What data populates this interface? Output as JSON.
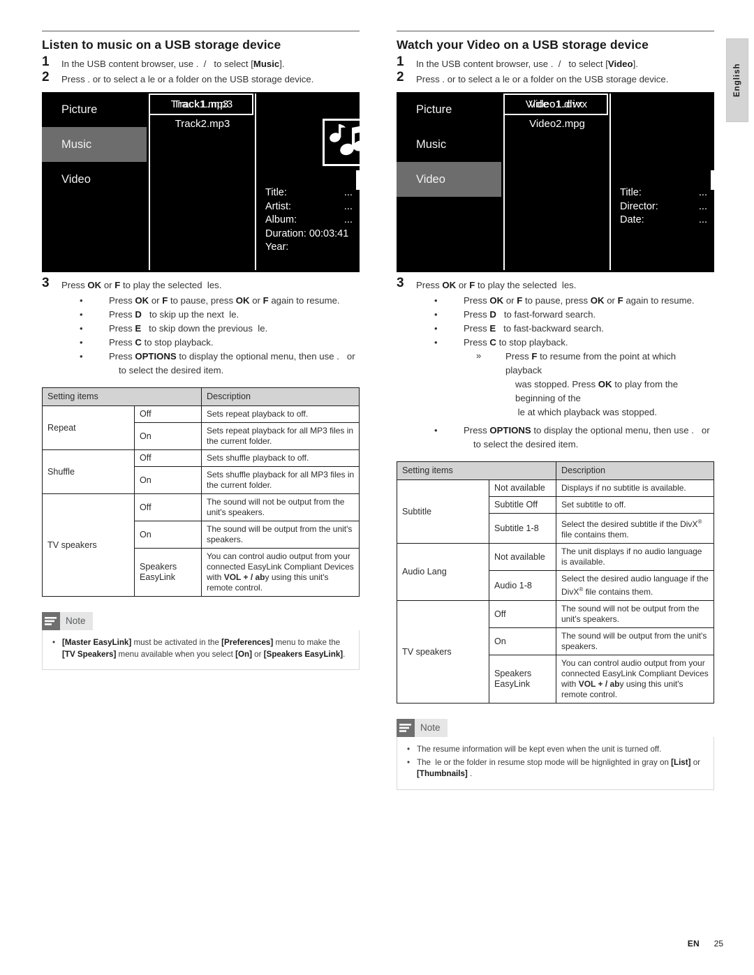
{
  "page": {
    "side_tab_label": "English",
    "footer_lang": "EN",
    "footer_page": "25"
  },
  "left": {
    "title": "Listen to music on a USB storage device",
    "steps": [
      {
        "num": "1",
        "text": "In the USB content browser, use .  /   to select [Music]."
      },
      {
        "num": "2",
        "text": "Press .   or    to select a  le or a folder on the USB storage device."
      }
    ],
    "screen": {
      "menu": [
        {
          "label": "Picture",
          "selected": false
        },
        {
          "label": "Music",
          "selected": true
        },
        {
          "label": "Video",
          "selected": false
        }
      ],
      "files": [
        {
          "label": "Track1.mp3",
          "highlighted": true
        },
        {
          "label": "Track2.mp3",
          "highlighted": false
        }
      ],
      "thumbnail_icon": "music-note-icon",
      "meta": [
        {
          "key": "Title:",
          "value": "..."
        },
        {
          "key": "Artist:",
          "value": "..."
        },
        {
          "key": "Album:",
          "value": "..."
        },
        {
          "key": "Duration: 00:03:41",
          "value": ""
        },
        {
          "key": "Year:",
          "value": ""
        }
      ]
    },
    "step3": {
      "num": "3",
      "text": "Press OK or F to play the selected  les.",
      "bullets": [
        "Press OK or  F to pause, press OK or F again to resume.",
        "Press D   to skip up the next  le.",
        "Press E   to skip down the previous  le.",
        "Press C to stop playback.",
        "Press OPTIONS to display the optional menu, then use .   or  to select the desired item."
      ]
    },
    "table": {
      "headers": [
        "Setting items",
        "Description"
      ],
      "rows": [
        {
          "cat": "Repeat",
          "catspan": 2,
          "opt": "Off",
          "desc": "Sets repeat playback to off."
        },
        {
          "cat": "",
          "opt": "On",
          "desc": "Sets repeat playback for all MP3 files in the current folder."
        },
        {
          "cat": "Shuffle",
          "catspan": 2,
          "opt": "Off",
          "desc": "Sets shuffle playback to off."
        },
        {
          "cat": "",
          "opt": "On",
          "desc": "Sets shuffle playback for all MP3 files in the current folder."
        },
        {
          "cat": "TV speakers",
          "catspan": 3,
          "opt": "Off",
          "desc": "The sound will not be output from the unit's speakers."
        },
        {
          "cat": "",
          "opt": "On",
          "desc": "The sound will be output from the unit's speakers."
        },
        {
          "cat": "",
          "opt": "Speakers EasyLink",
          "desc": "You can control audio output from your connected EasyLink Compliant Devices with ",
          "desc_bold": "VOL + / ab",
          "desc_tail": "y using this unit's remote control."
        }
      ]
    },
    "note": {
      "label": "Note",
      "items": [
        "[Master EasyLink] must be activated in the [Preferences] menu to make the [TV Speakers] menu available when you select [On] or [Speakers EasyLink]."
      ]
    }
  },
  "right": {
    "title": "Watch your Video on a USB storage device",
    "steps": [
      {
        "num": "1",
        "text": "In the USB content browser, use .  /   to select [Video]."
      },
      {
        "num": "2",
        "text": "Press .   or    to select a  le or a folder on the USB storage device."
      }
    ],
    "screen": {
      "menu": [
        {
          "label": "Picture",
          "selected": false
        },
        {
          "label": "Music",
          "selected": false
        },
        {
          "label": "Video",
          "selected": true
        }
      ],
      "files": [
        {
          "label": "Video1.divx",
          "highlighted": true
        },
        {
          "label": "Video2.mpg",
          "highlighted": false
        }
      ],
      "thumbnail_icon": "none",
      "meta": [
        {
          "key": "Title:",
          "value": "..."
        },
        {
          "key": "Director:",
          "value": "..."
        },
        {
          "key": "Date:",
          "value": "..."
        }
      ]
    },
    "step3": {
      "num": "3",
      "text": "Press OK or F to play the selected  les.",
      "bullets": [
        "Press OK or  F to pause, press OK or F again to resume.",
        "Press D   to fast-forward search.",
        "Press E   to fast-backward search.",
        "Press C to stop playback.",
        "Press OPTIONS to display the optional menu, then use .   or  to select the desired item."
      ],
      "subbullet": "Press  F to resume from the point at which playback was stopped. Press OK to play from the beginning of the  le at which playback was stopped."
    },
    "table": {
      "headers": [
        "Setting items",
        "Description"
      ],
      "rows": [
        {
          "cat": "Subtitle",
          "catspan": 3,
          "opt": "Not available",
          "desc": "Displays if no  subtitle is available."
        },
        {
          "cat": "",
          "opt": "Subtitle Off",
          "desc": "Set subtitle to off."
        },
        {
          "cat": "",
          "opt": "Subtitle 1-8",
          "desc": "Select the desired subtitle if the DivX® file contains them."
        },
        {
          "cat": "Audio Lang",
          "catspan": 2,
          "opt": "Not available",
          "desc": "The unit displays if no audio language is available."
        },
        {
          "cat": "",
          "opt": "Audio 1-8",
          "desc": "Select the desired audio language if the DivX® file contains them."
        },
        {
          "cat": "TV speakers",
          "catspan": 3,
          "opt": "Off",
          "desc": "The sound will not be output from the unit's speakers."
        },
        {
          "cat": "",
          "opt": "On",
          "desc": "The sound will be output from the unit's speakers."
        },
        {
          "cat": "",
          "opt": "Speakers EasyLink",
          "desc": "You can control audio output from your connected EasyLink Compliant Devices with ",
          "desc_bold": "VOL + / ab",
          "desc_tail": "y using this unit's remote control."
        }
      ]
    },
    "note": {
      "label": "Note",
      "items": [
        "The resume information will be kept even when the unit is turned off.",
        "The  le or the folder in resume stop mode will be hignlighted in gray on [List] or [Thumbnails] ."
      ]
    }
  }
}
